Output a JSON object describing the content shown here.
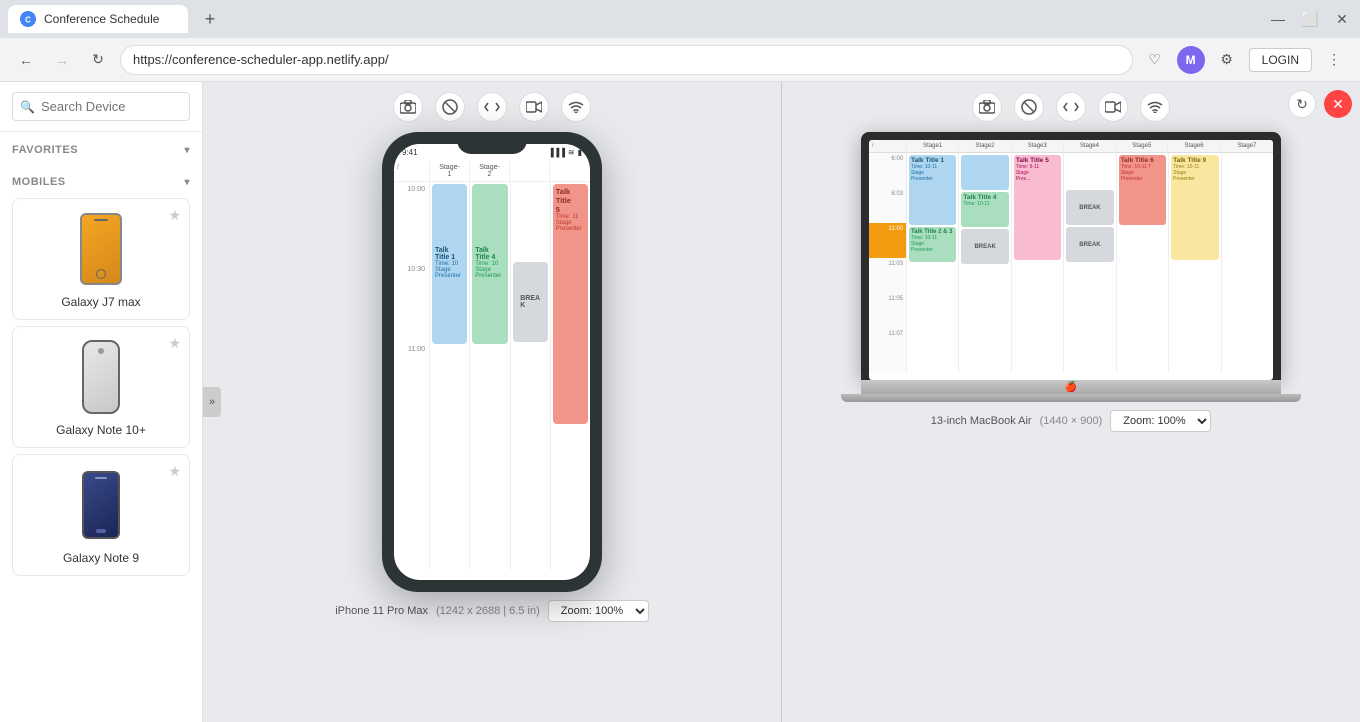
{
  "browser": {
    "tab_title": "Conference Schedule",
    "tab_favicon": "C",
    "new_tab_symbol": "+",
    "url": "https://conference-scheduler-app.netlify.app/",
    "nav": {
      "back_label": "←",
      "forward_label": "→",
      "reload_label": "↻"
    },
    "toolbar_icons": {
      "favorite": "♡",
      "avatar_initials": "M",
      "login_label": "LOGIN",
      "menu": "⋮"
    },
    "window_controls": {
      "minimize": "—",
      "maximize": "⬜",
      "close": "✕"
    }
  },
  "sidebar": {
    "search_placeholder": "Search Device",
    "sections": {
      "favorites": {
        "label": "FAVORITES",
        "chevron": "▾"
      },
      "mobiles": {
        "label": "MOBILES",
        "chevron": "▾"
      }
    },
    "devices": [
      {
        "name": "Galaxy J7 max",
        "color": "orange"
      },
      {
        "name": "Galaxy Note 10+",
        "color": "silver"
      },
      {
        "name": "Galaxy Note 9",
        "color": "dark-blue"
      }
    ]
  },
  "left_panel": {
    "toolbar_icons": [
      "📷",
      "🚫",
      "<>",
      "🎥",
      "📶"
    ],
    "device_label": "iPhone 11 Pro Max",
    "device_specs": "(1242 x 2688 | 6.5 in)",
    "zoom_label": "Zoom:",
    "zoom_value": "100%",
    "schedule": {
      "headers": [
        "/",
        "Stage-1",
        "Stage-2"
      ],
      "times": [
        "10:00",
        "10:30",
        "11:00"
      ],
      "talks": [
        {
          "title": "Talk Title 5",
          "time": "Time: 11",
          "stage": "Stage",
          "presenter": "Presenter",
          "color": "red",
          "col": 4,
          "rowSpan": 3
        },
        {
          "title": "Talk Title 1",
          "time": "Time: 10",
          "stage": "Stage",
          "presenter": "Presenter",
          "color": "blue",
          "col": 2,
          "rowSpan": 2
        },
        {
          "title": "Talk Title 4",
          "time": "Time: 10",
          "stage": "Stage",
          "presenter": "Presenter",
          "color": "green",
          "col": 3,
          "rowSpan": 2
        },
        {
          "title": "BREAK",
          "color": "gray",
          "col": 4
        }
      ]
    }
  },
  "right_panel": {
    "close_label": "✕",
    "refresh_label": "↻",
    "toolbar_icons": [
      "📷",
      "🚫",
      "<>",
      "🎥",
      "📶"
    ],
    "device_label": "13-inch MacBook Air",
    "device_specs": "(1440 × 900)",
    "zoom_label": "Zoom:",
    "zoom_value": "100%",
    "schedule": {
      "headers": [
        "/",
        "Stage1",
        "Stage2",
        "Stage3",
        "Stage4",
        "Stage5",
        "Stage6",
        "Stage7"
      ],
      "times": [
        "6:00",
        "6:03",
        "11:00",
        "11:03",
        "11:05",
        "11:07"
      ],
      "talks": []
    }
  },
  "divider": {
    "arrow": "»"
  }
}
